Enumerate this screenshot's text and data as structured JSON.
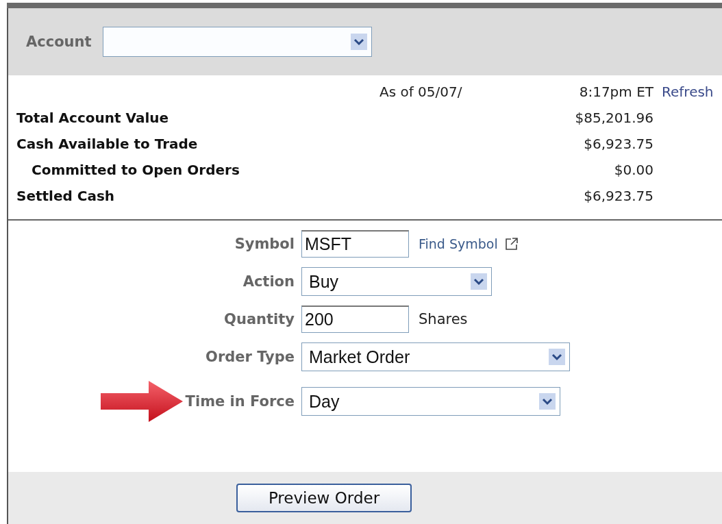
{
  "account": {
    "label": "Account"
  },
  "balances": {
    "as_of": "As of 05/07/",
    "time": "8:17pm ET",
    "refresh": "Refresh",
    "rows": [
      {
        "label": "Total Account Value",
        "value": "$85,201.96"
      },
      {
        "label": "Cash Available to Trade",
        "value": "$6,923.75",
        "children": [
          {
            "label": "Committed to Open Orders",
            "value": "$0.00"
          }
        ]
      },
      {
        "label": "Settled Cash",
        "value": "$6,923.75"
      }
    ]
  },
  "order_form": {
    "fields": [
      {
        "kind": "text",
        "label": "Symbol",
        "value": "MSFT",
        "link": "Find Symbol"
      },
      {
        "kind": "select",
        "label": "Action",
        "value": "Buy"
      },
      {
        "kind": "text",
        "label": "Quantity",
        "value": "200",
        "suffix": "Shares"
      },
      {
        "kind": "select",
        "label": "Order Type",
        "value": "Market Order"
      },
      {
        "kind": "select",
        "label": "Time in Force",
        "value": "Day",
        "pointer": true
      }
    ]
  },
  "buttons": [
    "Preview Order"
  ]
}
